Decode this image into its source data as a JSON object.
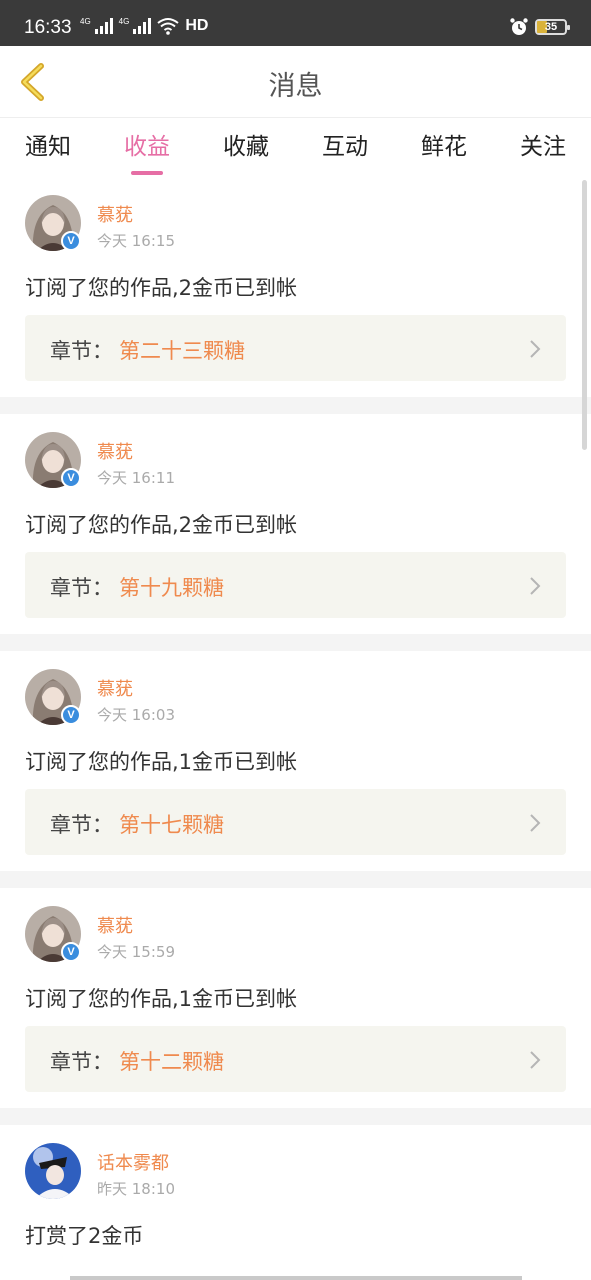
{
  "status_bar": {
    "time": "16:33",
    "signal_tag_1": "4G",
    "signal_tag_2": "4G",
    "hd_label": "HD",
    "battery_level": "35",
    "icons": [
      "signal-icon",
      "wifi-icon",
      "alarm-icon",
      "battery-icon"
    ]
  },
  "header": {
    "title": "消息",
    "back_icon": "chevron-left-icon"
  },
  "tabs": [
    {
      "label": "通知"
    },
    {
      "label": "收益",
      "active": true
    },
    {
      "label": "收藏"
    },
    {
      "label": "互动"
    },
    {
      "label": "鲜花"
    },
    {
      "label": "关注"
    }
  ],
  "colors": {
    "accent_pink": "#e66ea5",
    "name_orange": "#ef8a4e",
    "verified_blue": "#3a8dde",
    "chapter_bg": "#f5f5ef"
  },
  "feed": [
    {
      "user": "慕莸",
      "time": "今天 16:15",
      "message": "订阅了您的作品,2金币已到帐",
      "chapter_label": "章节：",
      "chapter_title": "第二十三颗糖",
      "verified": true
    },
    {
      "user": "慕莸",
      "time": "今天 16:11",
      "message": "订阅了您的作品,2金币已到帐",
      "chapter_label": "章节：",
      "chapter_title": "第十九颗糖",
      "verified": true
    },
    {
      "user": "慕莸",
      "time": "今天 16:03",
      "message": "订阅了您的作品,1金币已到帐",
      "chapter_label": "章节：",
      "chapter_title": "第十七颗糖",
      "verified": true
    },
    {
      "user": "慕莸",
      "time": "今天 15:59",
      "message": "订阅了您的作品,1金币已到帐",
      "chapter_label": "章节：",
      "chapter_title": "第十二颗糖",
      "verified": true
    },
    {
      "user": "话本雾都",
      "time": "昨天 18:10",
      "message": "打赏了2金币",
      "verified": false
    }
  ]
}
